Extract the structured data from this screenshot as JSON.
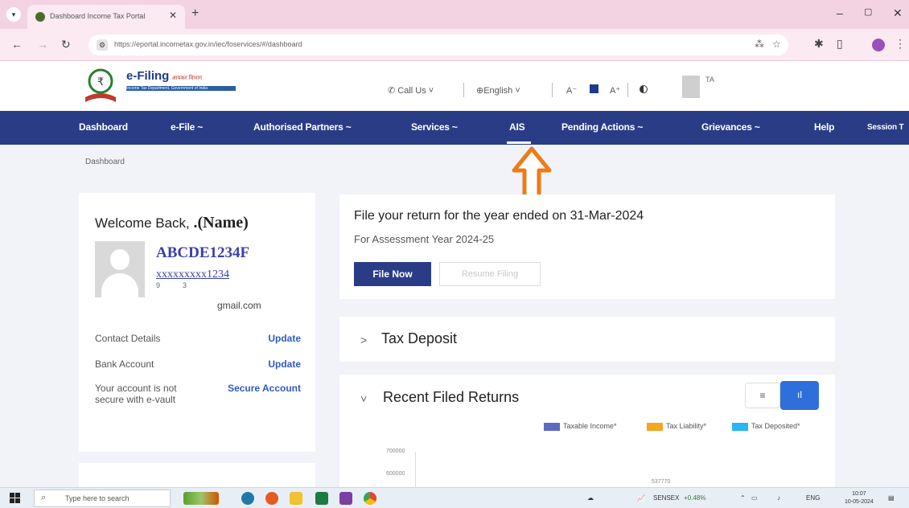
{
  "browser": {
    "tab_title": "Dashboard Income Tax Portal",
    "tab_close": "✕",
    "new_tab": "+",
    "url": "https://eportal.incometax.gov.in/iec/foservices/#/dashboard",
    "minimize": "–",
    "restore": "▢",
    "close": "✕"
  },
  "header": {
    "logo_text": "e-Filing",
    "logo_tagline_hindi": "आयकर विभाग",
    "logo_subtitle": "Income Tax Department, Government of India",
    "call_us": "Call Us",
    "language": "English",
    "text_smaller": "A⁻",
    "text_larger": "A⁺",
    "user_initials": "TA"
  },
  "nav": {
    "items": [
      {
        "label": "Dashboard"
      },
      {
        "label": "e-File ~"
      },
      {
        "label": "Authorised Partners ~"
      },
      {
        "label": "Services ~"
      },
      {
        "label": "AIS"
      },
      {
        "label": "Pending Actions ~"
      },
      {
        "label": "Grievances ~"
      },
      {
        "label": "Help"
      },
      {
        "label": "Session T"
      }
    ]
  },
  "breadcrumb": "Dashboard",
  "profile": {
    "welcome": "Welcome Back,",
    "name": ".(Name)",
    "pan": "ABCDE1234F",
    "masked_number": "xxxxxxxxx1234",
    "digits_a": "9",
    "digits_b": "3",
    "email": "gmail.com",
    "contact_label": "Contact Details",
    "contact_action": "Update",
    "bank_label": "Bank Account",
    "bank_action": "Update",
    "secure_label": "Your account is not secure with e-vault",
    "secure_action": "Secure Account"
  },
  "file_return": {
    "title": "File your return for the year ended on 31-Mar-2024",
    "subtitle": "For Assessment Year 2024-25",
    "file_now": "File Now",
    "resume": "Resume Filing"
  },
  "tax_deposit": {
    "chevron": ">",
    "title": "Tax Deposit"
  },
  "recent_returns": {
    "chevron": "˅",
    "title": "Recent Filed Returns",
    "list_view": "≡",
    "chart_view": "ıl",
    "legend": [
      {
        "label": "Taxable Income*",
        "color": "#5c6bc0"
      },
      {
        "label": "Tax Liability*",
        "color": "#f5a623"
      },
      {
        "label": "Tax Deposited*",
        "color": "#29b6f6"
      }
    ],
    "y_ticks": [
      "700000",
      "600000"
    ],
    "bar_value": "537770"
  },
  "taskbar": {
    "search_placeholder": "Type here to search",
    "sensex": "SENSEX",
    "sensex_change": "+0.48%",
    "lang": "ENG",
    "time": "10:07",
    "date": "10-05-2024"
  },
  "annotation_color": "#f07a1a"
}
